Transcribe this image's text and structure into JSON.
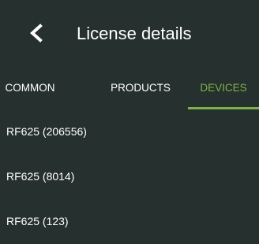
{
  "header": {
    "back_icon": "chevron-left-icon",
    "title": "License details"
  },
  "tabs": [
    {
      "label": "COMMON",
      "active": false
    },
    {
      "label": "PRODUCTS",
      "active": false
    },
    {
      "label": "DEVICES",
      "active": true
    }
  ],
  "colors": {
    "background": "#26302e",
    "accent": "#7fb04a",
    "text": "#ffffff"
  },
  "devices": [
    {
      "label": "RF625 (206556)"
    },
    {
      "label": "RF625 (8014)"
    },
    {
      "label": "RF625 (123)"
    }
  ]
}
